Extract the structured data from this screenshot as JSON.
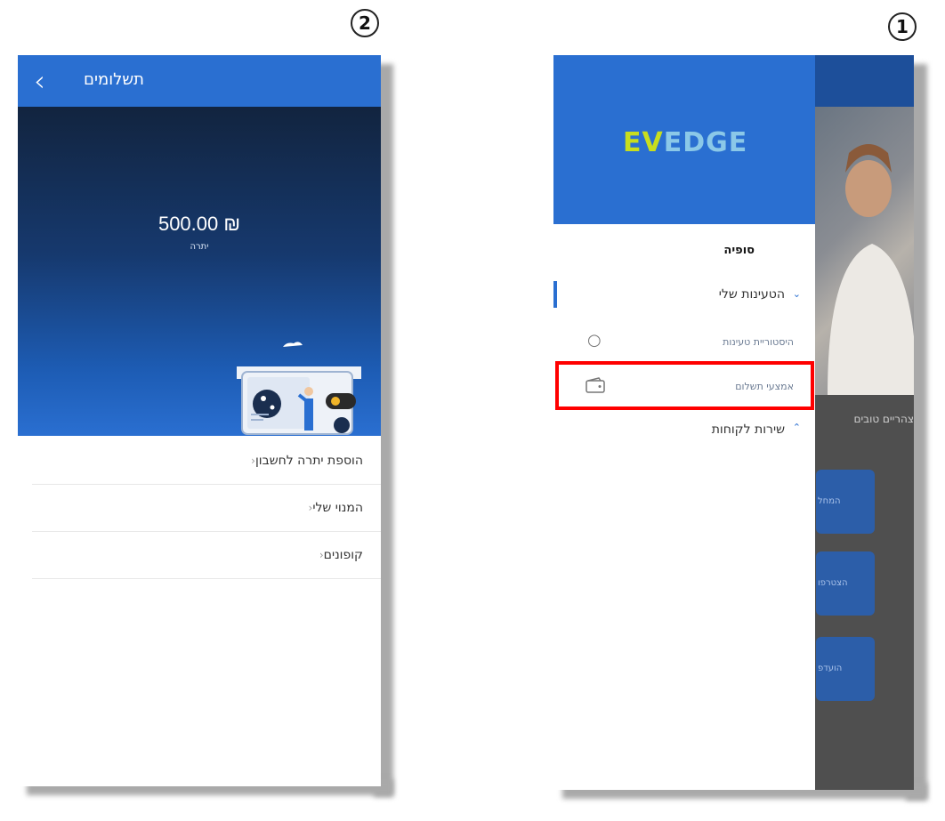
{
  "screens": {
    "left": {
      "badge": "2",
      "header": {
        "title": "תשלומים",
        "back_icon": "chevron-left-icon"
      },
      "balance": {
        "amount": "500.00 ₪",
        "label": "יתרה"
      },
      "menu": [
        {
          "label": "הוספת יתרה לחשבון",
          "icon": "chevron-left-icon"
        },
        {
          "label": "המנוי שלי",
          "icon": "chevron-left-icon"
        },
        {
          "label": "קופונים",
          "icon": "chevron-left-icon"
        }
      ]
    },
    "right": {
      "badge": "1",
      "logo": {
        "part1": "EV",
        "part2": "EDGE"
      },
      "user_name": "סופיה",
      "nav": [
        {
          "label": "הטעינות שלי",
          "icon": "chevron-down-icon"
        },
        {
          "label": "היסטוריית טעינות",
          "icon": "circle-icon"
        },
        {
          "label": "אמצעי תשלום",
          "icon": "wallet-icon"
        },
        {
          "label": "שירות לקוחות",
          "icon": "chevron-up-icon"
        }
      ],
      "background": {
        "greeting": "צהריים טובים",
        "buttons": [
          "המחל",
          "הצטרפו",
          "הועדפ"
        ]
      }
    }
  },
  "colors": {
    "header_blue": "#2a6fd1",
    "highlight_red": "#ff0000",
    "logo_green": "#c8de1e",
    "logo_blue": "#8bc8e8"
  }
}
